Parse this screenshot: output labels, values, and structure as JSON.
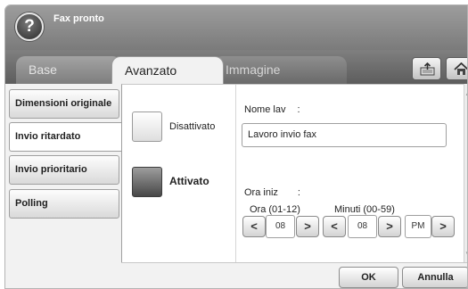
{
  "header": {
    "title": "Fax pronto",
    "help_icon": "?"
  },
  "tabs": [
    {
      "label": "Base",
      "active": false
    },
    {
      "label": "Avanzato",
      "active": true
    },
    {
      "label": "Immagine",
      "active": false
    }
  ],
  "toolbar": {
    "export_icon": "export-icon",
    "home_icon": "home-icon"
  },
  "sidebar": {
    "items": [
      {
        "label": "Dimensioni originale",
        "active": false
      },
      {
        "label": "Invio ritardato",
        "active": true
      },
      {
        "label": "Invio prioritario",
        "active": false
      },
      {
        "label": "Polling",
        "active": false
      }
    ]
  },
  "options": {
    "off_label": "Disattivato",
    "on_label": "Attivato",
    "selected": "Attivato"
  },
  "job": {
    "label": "Nome lav",
    "separator": ":",
    "value": "Lavoro invio fax"
  },
  "start_time": {
    "label": "Ora iniz",
    "separator": ":",
    "hour_label": "Ora (01-12)",
    "hour_value": "08",
    "minutes_label": "Minuti (00-59)",
    "minutes_value": "08",
    "ampm_value": "PM",
    "dec_symbol": "<",
    "inc_symbol": ">"
  },
  "footer": {
    "ok_label": "OK",
    "cancel_label": "Annulla"
  },
  "colors": {
    "header_bg": "#8c8c8c",
    "active_option": "#4a4a4a",
    "panel_bg": "#ffffff"
  }
}
